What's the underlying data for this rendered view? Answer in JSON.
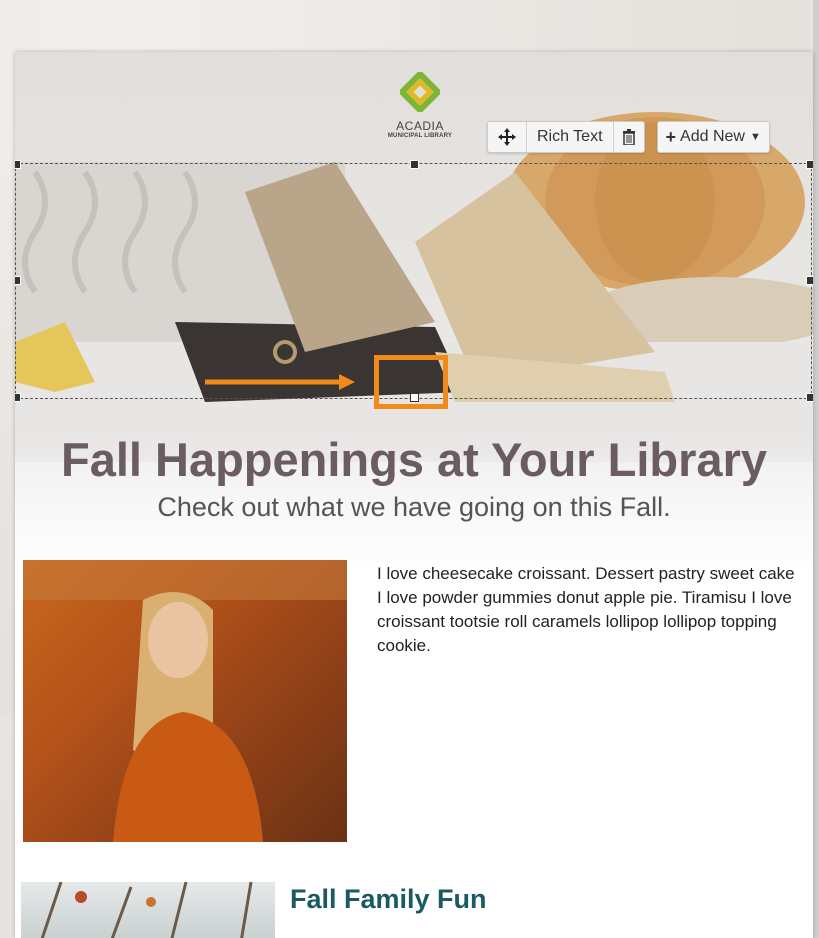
{
  "logo": {
    "name": "ACADIA",
    "tagline": "MUNICIPAL LIBRARY"
  },
  "toolbar": {
    "move_icon": "move-arrows-icon",
    "block_type_label": "Rich Text",
    "delete_icon": "trash-icon",
    "add_new_label": "Add New",
    "add_icon": "plus-icon",
    "dropdown_icon": "caret-down-icon"
  },
  "hero": {
    "headline": "Fall Happenings at Your Library",
    "subheadline": "Check out what we have going on this Fall."
  },
  "content": {
    "paragraph": "I love cheesecake croissant. Dessert pastry sweet cake I love powder gummies donut apple pie. Tiramisu I love croissant tootsie roll caramels lollipop lollipop topping cookie.",
    "section_title": "Fall Family Fun"
  },
  "annotation": {
    "highlight_color": "#f08a1b"
  },
  "colors": {
    "headline": "#6b5b63",
    "section_title": "#1c5a63",
    "logo_green": "#7fb536",
    "logo_yellow": "#e1b824"
  }
}
